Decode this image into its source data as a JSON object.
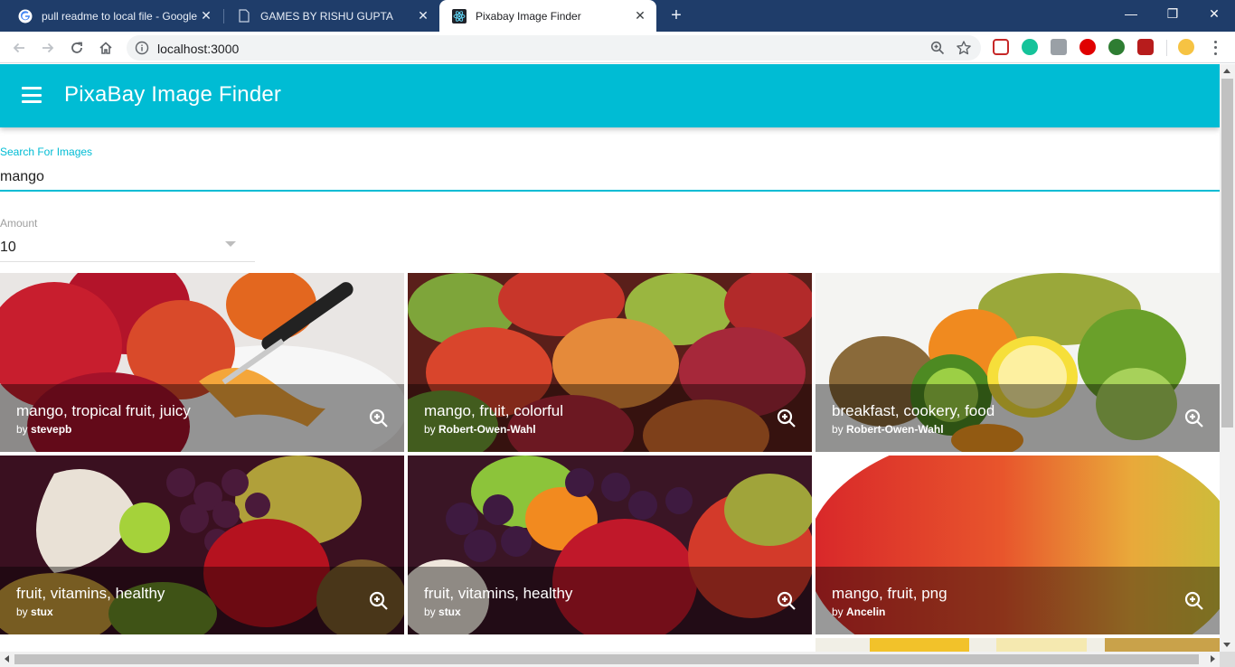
{
  "browser": {
    "tabs": [
      {
        "title": "pull readme to local file - Google",
        "close": "✕"
      },
      {
        "title": "GAMES BY RISHU GUPTA",
        "close": "✕"
      },
      {
        "title": "Pixabay Image Finder",
        "close": "✕"
      }
    ],
    "new_tab": "+",
    "window_controls": {
      "minimize": "—",
      "restore": "❐",
      "close": "✕"
    },
    "address": "localhost:3000"
  },
  "app": {
    "title": "PixaBay Image Finder",
    "accent_color": "#00bcd4"
  },
  "search": {
    "label": "Search For Images",
    "value": "mango"
  },
  "amount": {
    "label": "Amount",
    "value": "10"
  },
  "results": [
    {
      "tags": "mango, tropical fruit, juicy",
      "by": "by ",
      "user": "stevepb"
    },
    {
      "tags": "mango, fruit, colorful",
      "by": "by ",
      "user": "Robert-Owen-Wahl"
    },
    {
      "tags": "breakfast, cookery, food",
      "by": "by ",
      "user": "Robert-Owen-Wahl"
    },
    {
      "tags": "fruit, vitamins, healthy",
      "by": "by ",
      "user": "stux"
    },
    {
      "tags": "fruit, vitamins, healthy",
      "by": "by ",
      "user": "stux"
    },
    {
      "tags": "mango, fruit, png",
      "by": "by ",
      "user": "Ancelin"
    }
  ]
}
